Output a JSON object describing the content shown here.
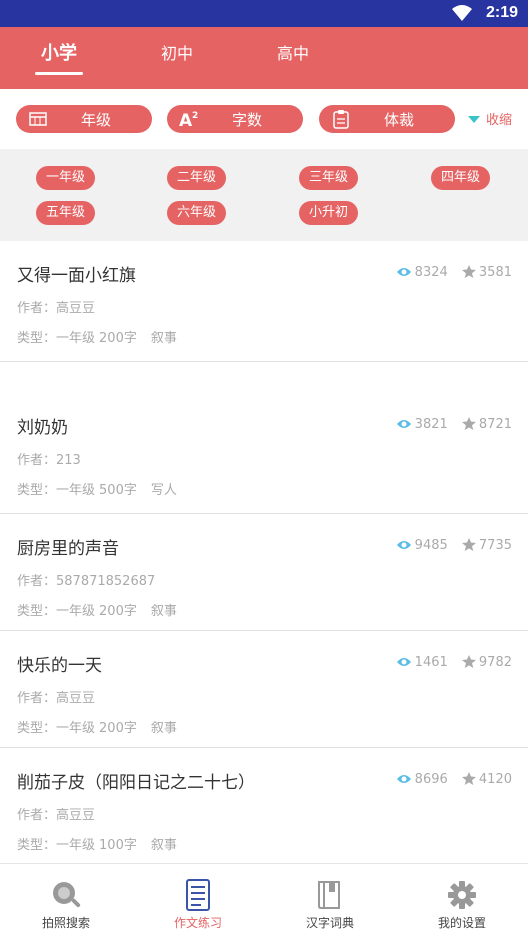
{
  "status_bar": {
    "time": "2:19"
  },
  "level_tabs": [
    {
      "label": "小学",
      "active": true
    },
    {
      "label": "初中",
      "active": false
    },
    {
      "label": "高中",
      "active": false
    }
  ],
  "filters": {
    "grade_label": "年级",
    "wordcount_label": "字数",
    "genre_label": "体裁",
    "collapse_label": "收缩"
  },
  "grades": [
    "一年级",
    "二年级",
    "三年级",
    "四年级",
    "五年级",
    "六年级",
    "小升初"
  ],
  "articles": [
    {
      "title": "又得一面小红旗",
      "author": "作者：高豆豆",
      "type_label": "类型：",
      "grade": "一年级",
      "words": "200字",
      "genre": "叙事",
      "views": "8324",
      "stars": "3581"
    },
    {
      "title": "刘奶奶",
      "author": "作者：213",
      "type_label": "类型：",
      "grade": "一年级",
      "words": "500字",
      "genre": "写人",
      "views": "3821",
      "stars": "8721"
    },
    {
      "title": "厨房里的声音",
      "author": "作者：587871852687",
      "type_label": "类型：",
      "grade": "一年级",
      "words": "200字",
      "genre": "叙事",
      "views": "9485",
      "stars": "7735"
    },
    {
      "title": "快乐的一天",
      "author": "作者：高豆豆",
      "type_label": "类型：",
      "grade": "一年级",
      "words": "200字",
      "genre": "叙事",
      "views": "1461",
      "stars": "9782"
    },
    {
      "title": "削茄子皮（阳阳日记之二十七）",
      "author": "作者：高豆豆",
      "type_label": "类型：",
      "grade": "一年级",
      "words": "100字",
      "genre": "叙事",
      "views": "8696",
      "stars": "4120"
    }
  ],
  "bottom_nav": [
    {
      "label": "拍照搜索",
      "icon": "camera-search-icon",
      "active": false
    },
    {
      "label": "作文练习",
      "icon": "document-list-icon",
      "active": true
    },
    {
      "label": "汉字词典",
      "icon": "dictionary-book-icon",
      "active": false
    },
    {
      "label": "我的设置",
      "icon": "gear-icon",
      "active": false
    }
  ],
  "colors": {
    "accent": "#e56363",
    "status_bar": "#2834a0",
    "view_icon": "#5bbde6",
    "star_icon": "#aaaaaa",
    "active_nav_icon": "#3a55a8"
  }
}
